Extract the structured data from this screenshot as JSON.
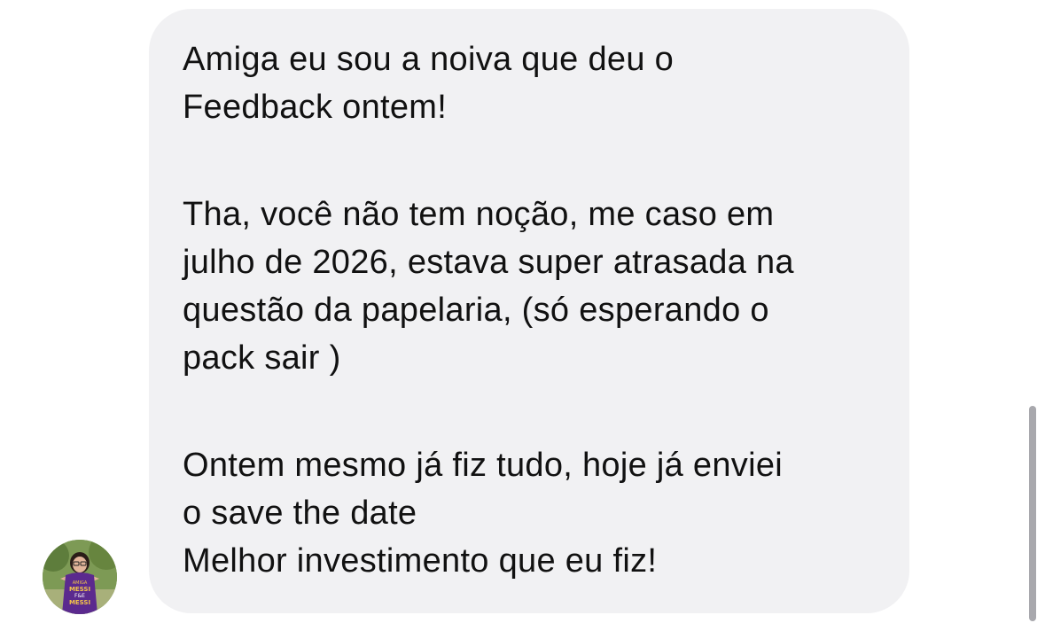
{
  "message": {
    "paragraphs": [
      {
        "lines": [
          "Amiga eu sou a noiva que deu o",
          "Feedback ontem!"
        ]
      },
      {
        "lines": [
          "Tha, você não tem noção, me caso em",
          "julho de 2026, estava super atrasada na",
          "questão da papelaria, (só esperando o",
          "pack sair )"
        ]
      },
      {
        "lines": [
          "Ontem mesmo já fiz tudo, hoje já enviei",
          "o save the date",
          "Melhor investimento que eu fiz!"
        ]
      }
    ]
  },
  "avatar": {
    "icon": "profile-photo",
    "shirt_text": [
      "AMIGA",
      "MESSI",
      "F&E",
      "MESSI"
    ]
  },
  "colors": {
    "bubble": "#f1f1f3",
    "text": "#111111",
    "scrollbar": "#a8a8ad"
  }
}
